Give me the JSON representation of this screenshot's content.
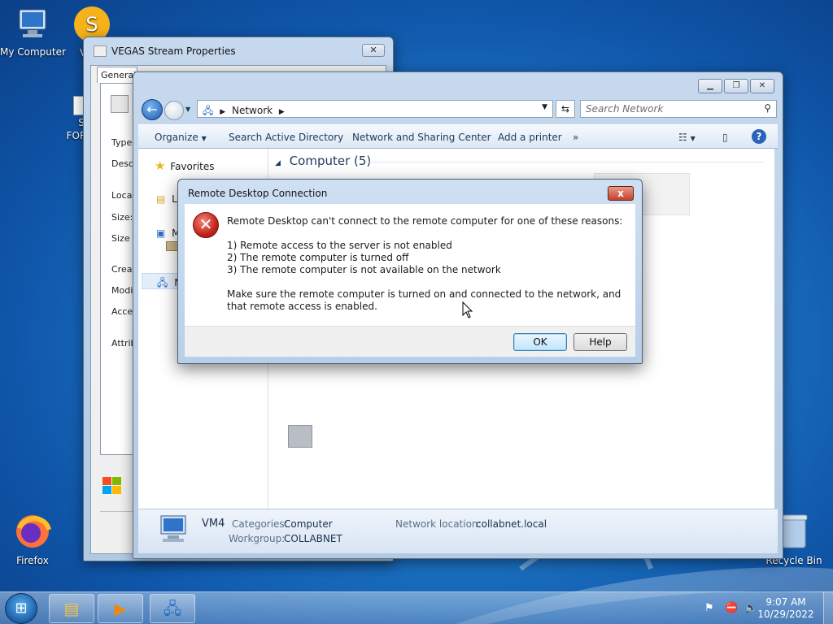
{
  "desktop": {
    "icons": [
      {
        "label": "My Computer",
        "icon": "computer-icon"
      },
      {
        "label": "Firefox",
        "icon": "firefox-icon"
      },
      {
        "label": "Recycle Bin",
        "icon": "recycle-bin-icon"
      }
    ],
    "partial_labels": [
      "Vi",
      "S",
      "S",
      "FOR"
    ]
  },
  "vegas_window": {
    "title": "VEGAS Stream Properties",
    "tab": "General",
    "fields": [
      "Type",
      "Descr",
      "Locati",
      "Size:",
      "Size o",
      "Creat",
      "Modif",
      "Acces",
      "Attrib"
    ]
  },
  "explorer": {
    "address": "Network",
    "search_placeholder": "Search Network",
    "commands": {
      "organize": "Organize",
      "search_ad": "Search Active Directory",
      "network_sharing": "Network and Sharing Center",
      "add_printer": "Add a printer",
      "more": "»"
    },
    "nav": {
      "favorites": "Favorites",
      "partial": [
        "L",
        "M",
        "N"
      ]
    },
    "group_header": "Computer (5)",
    "details": {
      "name": "VM4",
      "categories_label": "Categories:",
      "categories_value": "Computer",
      "workgroup_label": "Workgroup:",
      "workgroup_value": "COLLABNET",
      "netloc_label": "Network location:",
      "netloc_value": "collabnet.local"
    }
  },
  "dialog": {
    "title": "Remote Desktop Connection",
    "close_glyph": "x",
    "message": "Remote Desktop can't connect to the remote computer for one of these reasons:",
    "reasons": [
      "1) Remote access to the server is not enabled",
      "2) The remote computer is turned off",
      "3) The remote computer is not available on the network"
    ],
    "advice": "Make sure the remote computer is turned on and connected to the network, and that remote access is enabled.",
    "ok_label": "OK",
    "help_label": "Help"
  },
  "taskbar": {
    "time": "9:07 AM",
    "date": "10/29/2022"
  },
  "colors": {
    "wallpaper": "#1f78c8",
    "error_red": "#c4241a",
    "link_blue": "#1e395b"
  }
}
